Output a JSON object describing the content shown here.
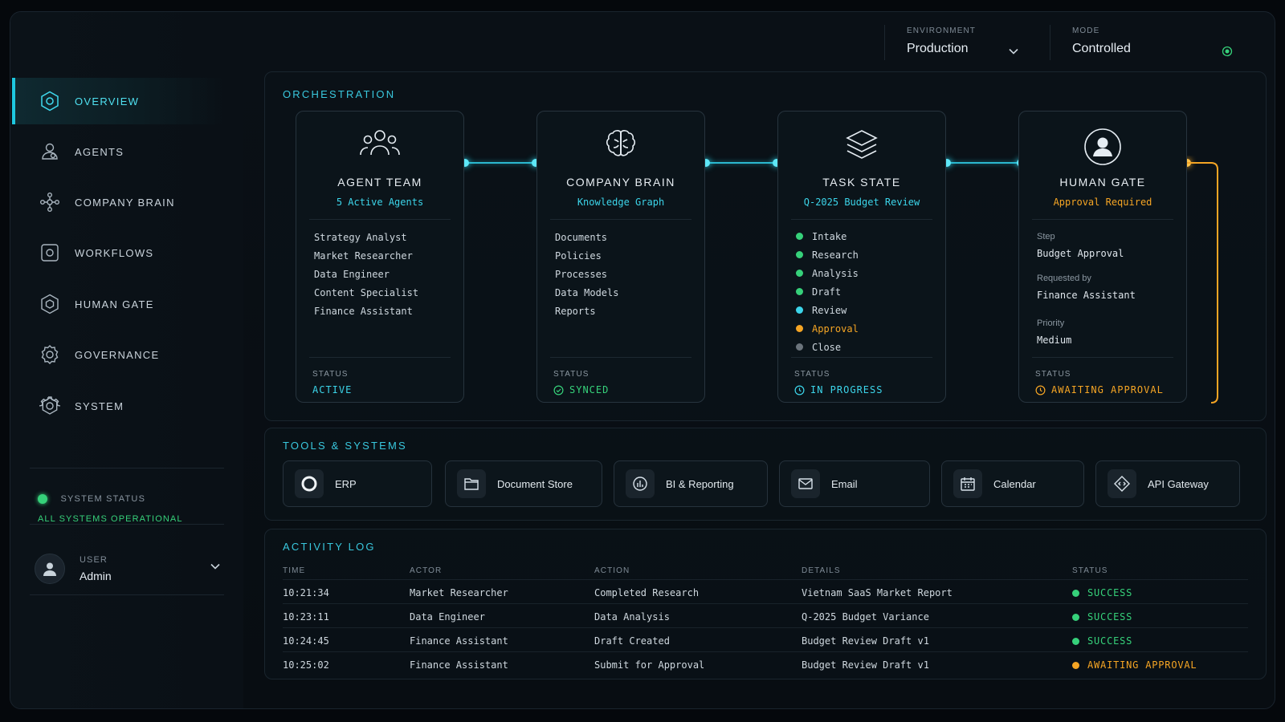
{
  "topbar": {
    "environment": {
      "label": "ENVIRONMENT",
      "value": "Production"
    },
    "mode": {
      "label": "MODE",
      "value": "Controlled"
    }
  },
  "sidebar": {
    "items": [
      {
        "label": "OVERVIEW",
        "icon": "hexagon-icon",
        "active": true
      },
      {
        "label": "AGENTS",
        "icon": "agents-icon"
      },
      {
        "label": "COMPANY BRAIN",
        "icon": "network-icon"
      },
      {
        "label": "WORKFLOWS",
        "icon": "workflow-icon"
      },
      {
        "label": "HUMAN GATE",
        "icon": "shield-icon"
      },
      {
        "label": "GOVERNANCE",
        "icon": "governance-icon"
      },
      {
        "label": "SYSTEM",
        "icon": "gear-icon"
      }
    ],
    "system_status": {
      "label": "SYSTEM STATUS",
      "value": "ALL SYSTEMS OPERATIONAL"
    },
    "user": {
      "label": "USER",
      "name": "Admin"
    }
  },
  "orchestration": {
    "title": "ORCHESTRATION",
    "cards": [
      {
        "title": "AGENT TEAM",
        "subtitle": "5 Active Agents",
        "items": [
          "Strategy Analyst",
          "Market Researcher",
          "Data Engineer",
          "Content Specialist",
          "Finance Assistant"
        ],
        "status_label": "STATUS",
        "status": "ACTIVE"
      },
      {
        "title": "COMPANY BRAIN",
        "subtitle": "Knowledge Graph",
        "items": [
          "Documents",
          "Policies",
          "Processes",
          "Data Models",
          "Reports"
        ],
        "status_label": "STATUS",
        "status": "SYNCED"
      },
      {
        "title": "TASK STATE",
        "subtitle": "Q-2025 Budget Review",
        "steps": [
          {
            "label": "Intake",
            "state": "done"
          },
          {
            "label": "Research",
            "state": "done"
          },
          {
            "label": "Analysis",
            "state": "done"
          },
          {
            "label": "Draft",
            "state": "done"
          },
          {
            "label": "Review",
            "state": "current"
          },
          {
            "label": "Approval",
            "state": "pending"
          },
          {
            "label": "Close",
            "state": "todo"
          }
        ],
        "status_label": "STATUS",
        "status": "IN PROGRESS"
      },
      {
        "title": "HUMAN GATE",
        "subtitle": "Approval Required",
        "fields": [
          {
            "label": "Step",
            "value": "Budget Approval"
          },
          {
            "label": "Requested by",
            "value": "Finance Assistant"
          },
          {
            "label": "Priority",
            "value": "Medium"
          }
        ],
        "status_label": "STATUS",
        "status": "AWAITING APPROVAL"
      }
    ]
  },
  "tools": {
    "title": "TOOLS & SYSTEMS",
    "items": [
      {
        "label": "ERP",
        "icon": "ring-icon"
      },
      {
        "label": "Document Store",
        "icon": "folder-icon"
      },
      {
        "label": "BI & Reporting",
        "icon": "chart-icon"
      },
      {
        "label": "Email",
        "icon": "mail-icon"
      },
      {
        "label": "Calendar",
        "icon": "calendar-icon"
      },
      {
        "label": "API Gateway",
        "icon": "code-diamond-icon"
      }
    ]
  },
  "activity": {
    "title": "ACTIVITY LOG",
    "columns": [
      "TIME",
      "ACTOR",
      "ACTION",
      "DETAILS",
      "STATUS"
    ],
    "rows": [
      {
        "time": "10:21:34",
        "actor": "Market Researcher",
        "action": "Completed Research",
        "details": "Vietnam SaaS Market Report",
        "status": "SUCCESS"
      },
      {
        "time": "10:23:11",
        "actor": "Data Engineer",
        "action": "Data Analysis",
        "details": "Q-2025 Budget Variance",
        "status": "SUCCESS"
      },
      {
        "time": "10:24:45",
        "actor": "Finance Assistant",
        "action": "Draft Created",
        "details": "Budget Review Draft v1",
        "status": "SUCCESS"
      },
      {
        "time": "10:25:02",
        "actor": "Finance Assistant",
        "action": "Submit for Approval",
        "details": "Budget Review Draft v1",
        "status": "AWAITING APPROVAL"
      }
    ]
  },
  "colors": {
    "accent": "#39c8de",
    "success": "#36d17a",
    "warning": "#f5a524",
    "muted": "#7f8b96"
  }
}
